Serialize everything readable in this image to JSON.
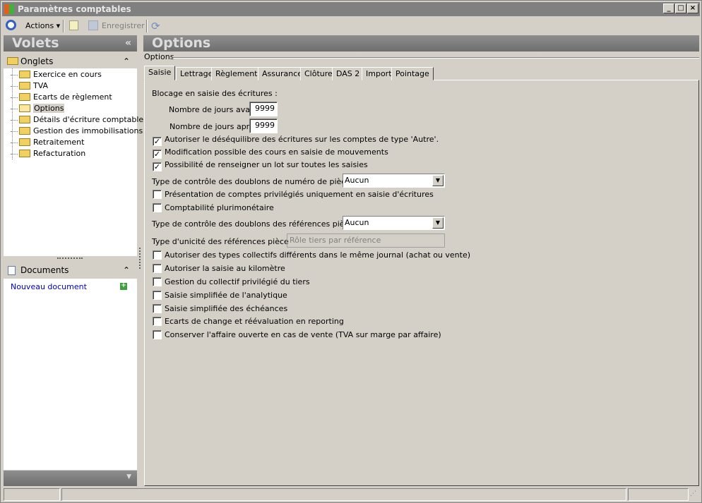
{
  "window": {
    "title": "Paramètres comptables"
  },
  "toolbar": {
    "actions": "Actions",
    "save": "Enregistrer"
  },
  "left": {
    "title": "Volets",
    "collapse": "«",
    "onglets": {
      "label": "Onglets",
      "items": [
        "Exercice en cours",
        "TVA",
        "Ecarts de règlement",
        "Options",
        "Détails d'écriture comptable",
        "Gestion des immobilisations",
        "Retraitement",
        "Refacturation"
      ],
      "selected": "Options"
    },
    "documents": {
      "label": "Documents",
      "new_doc": "Nouveau document"
    }
  },
  "main": {
    "title": "Options",
    "group": "Options",
    "tabs": [
      "Saisie",
      "Lettrage",
      "Règlements",
      "Assurance",
      "Clôture",
      "DAS 2",
      "Import",
      "Pointage"
    ],
    "active_tab": "Saisie",
    "blocage_label": "Blocage en saisie des écritures :",
    "jours_avant_label": "Nombre de jours avant",
    "jours_avant": "9999",
    "jours_apres_label": "Nombre de jours après",
    "jours_apres": "9999",
    "checks1": [
      {
        "label": "Autoriser le déséquilibre des écritures sur les comptes de type 'Autre'.",
        "checked": true
      },
      {
        "label": "Modification possible des cours en saisie de mouvements",
        "checked": true
      },
      {
        "label": "Possibilité de renseigner un lot sur toutes les saisies",
        "checked": true
      }
    ],
    "doublons_piece_label": "Type de contrôle des doublons de numéro de pièce",
    "doublons_piece": "Aucun",
    "checks2": [
      {
        "label": "Présentation de comptes privilégiés uniquement en saisie d'écritures",
        "checked": false
      },
      {
        "label": "Comptabilité plurimonétaire",
        "checked": false
      }
    ],
    "doublons_ref_label": "Type de contrôle des doublons des références pièce",
    "doublons_ref": "Aucun",
    "unicite_label": "Type d'unicité des références pièce",
    "unicite": "Rôle tiers par référence",
    "checks3": [
      {
        "label": "Autoriser des types collectifs différents dans le même journal (achat ou vente)",
        "checked": false
      },
      {
        "label": "Autoriser la saisie au kilomètre",
        "checked": false
      },
      {
        "label": "Gestion du collectif privilégié du tiers",
        "checked": false
      },
      {
        "label": "Saisie simplifiée de l'analytique",
        "checked": false
      },
      {
        "label": "Saisie simplifiée des échéances",
        "checked": false
      },
      {
        "label": "Ecarts de change et réévaluation en reporting",
        "checked": false
      },
      {
        "label": "Conserver l'affaire ouverte en cas de vente (TVA sur marge par affaire)",
        "checked": false
      }
    ]
  }
}
